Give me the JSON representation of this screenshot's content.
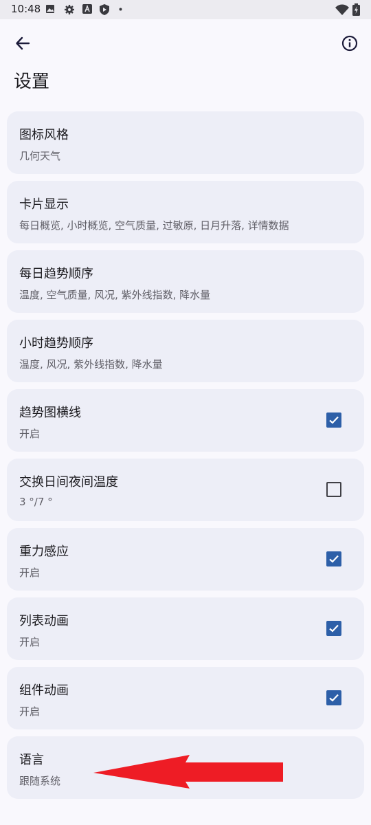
{
  "status_bar": {
    "time": "10:48"
  },
  "page_title": "设置",
  "settings": [
    {
      "title": "图标风格",
      "subtitle": "几何天气"
    },
    {
      "title": "卡片显示",
      "subtitle": "每日概览, 小时概览, 空气质量, 过敏原, 日月升落, 详情数据"
    },
    {
      "title": "每日趋势顺序",
      "subtitle": "温度, 空气质量, 风况, 紫外线指数, 降水量"
    },
    {
      "title": "小时趋势顺序",
      "subtitle": "温度, 风况, 紫外线指数, 降水量"
    },
    {
      "title": "趋势图横线",
      "subtitle": "开启",
      "checked": true
    },
    {
      "title": "交换日间夜间温度",
      "subtitle": "3 °/7 °",
      "checked": false
    },
    {
      "title": "重力感应",
      "subtitle": "开启",
      "checked": true
    },
    {
      "title": "列表动画",
      "subtitle": "开启",
      "checked": true
    },
    {
      "title": "组件动画",
      "subtitle": "开启",
      "checked": true
    },
    {
      "title": "语言",
      "subtitle": "跟随系统"
    }
  ],
  "colors": {
    "accent": "#2d5fa8",
    "card_bg": "#edeef7",
    "annotation_arrow": "#ee1c25"
  }
}
